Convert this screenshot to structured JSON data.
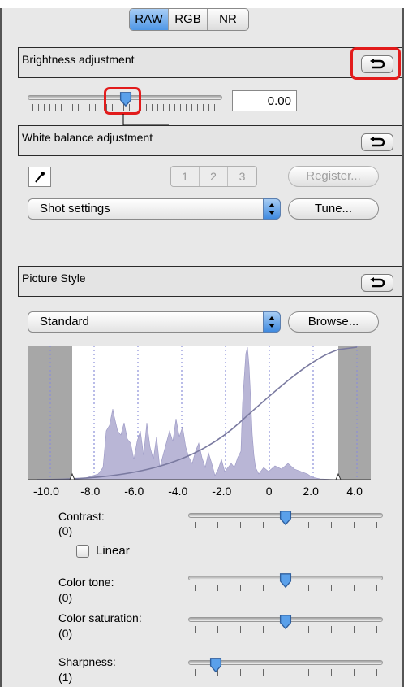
{
  "tabs": [
    {
      "label": "RAW",
      "active": true
    },
    {
      "label": "RGB",
      "active": false
    },
    {
      "label": "NR",
      "active": false
    }
  ],
  "brightness": {
    "title": "Brightness adjustment",
    "value": "0.00",
    "slider_fraction": 0.5
  },
  "white_balance": {
    "title": "White balance adjustment",
    "presets": [
      "1",
      "2",
      "3"
    ],
    "register_label": "Register...",
    "mode": "Shot settings",
    "tune_label": "Tune..."
  },
  "picture_style": {
    "title": "Picture Style",
    "style": "Standard",
    "browse_label": "Browse...",
    "histogram_axis": [
      "-10.0",
      "-8.0",
      "-6.0",
      "-4.0",
      "-2.0",
      "0",
      "2.0",
      "4.0"
    ]
  },
  "adjustments": {
    "contrast_label": "Contrast:",
    "contrast_value": "(0)",
    "contrast_fraction": 0.5,
    "linear_label": "Linear",
    "color_tone_label": "Color tone:",
    "color_tone_value": "(0)",
    "color_tone_fraction": 0.5,
    "color_saturation_label": "Color saturation:",
    "color_saturation_value": "(0)",
    "color_saturation_fraction": 0.5,
    "sharpness_label": "Sharpness:",
    "sharpness_value": "(1)",
    "sharpness_fraction": 0.14
  },
  "colors": {
    "highlight": "#e21b1b",
    "accent_blue": "#4f97e6",
    "histogram_fill": "#b9b6d6"
  }
}
